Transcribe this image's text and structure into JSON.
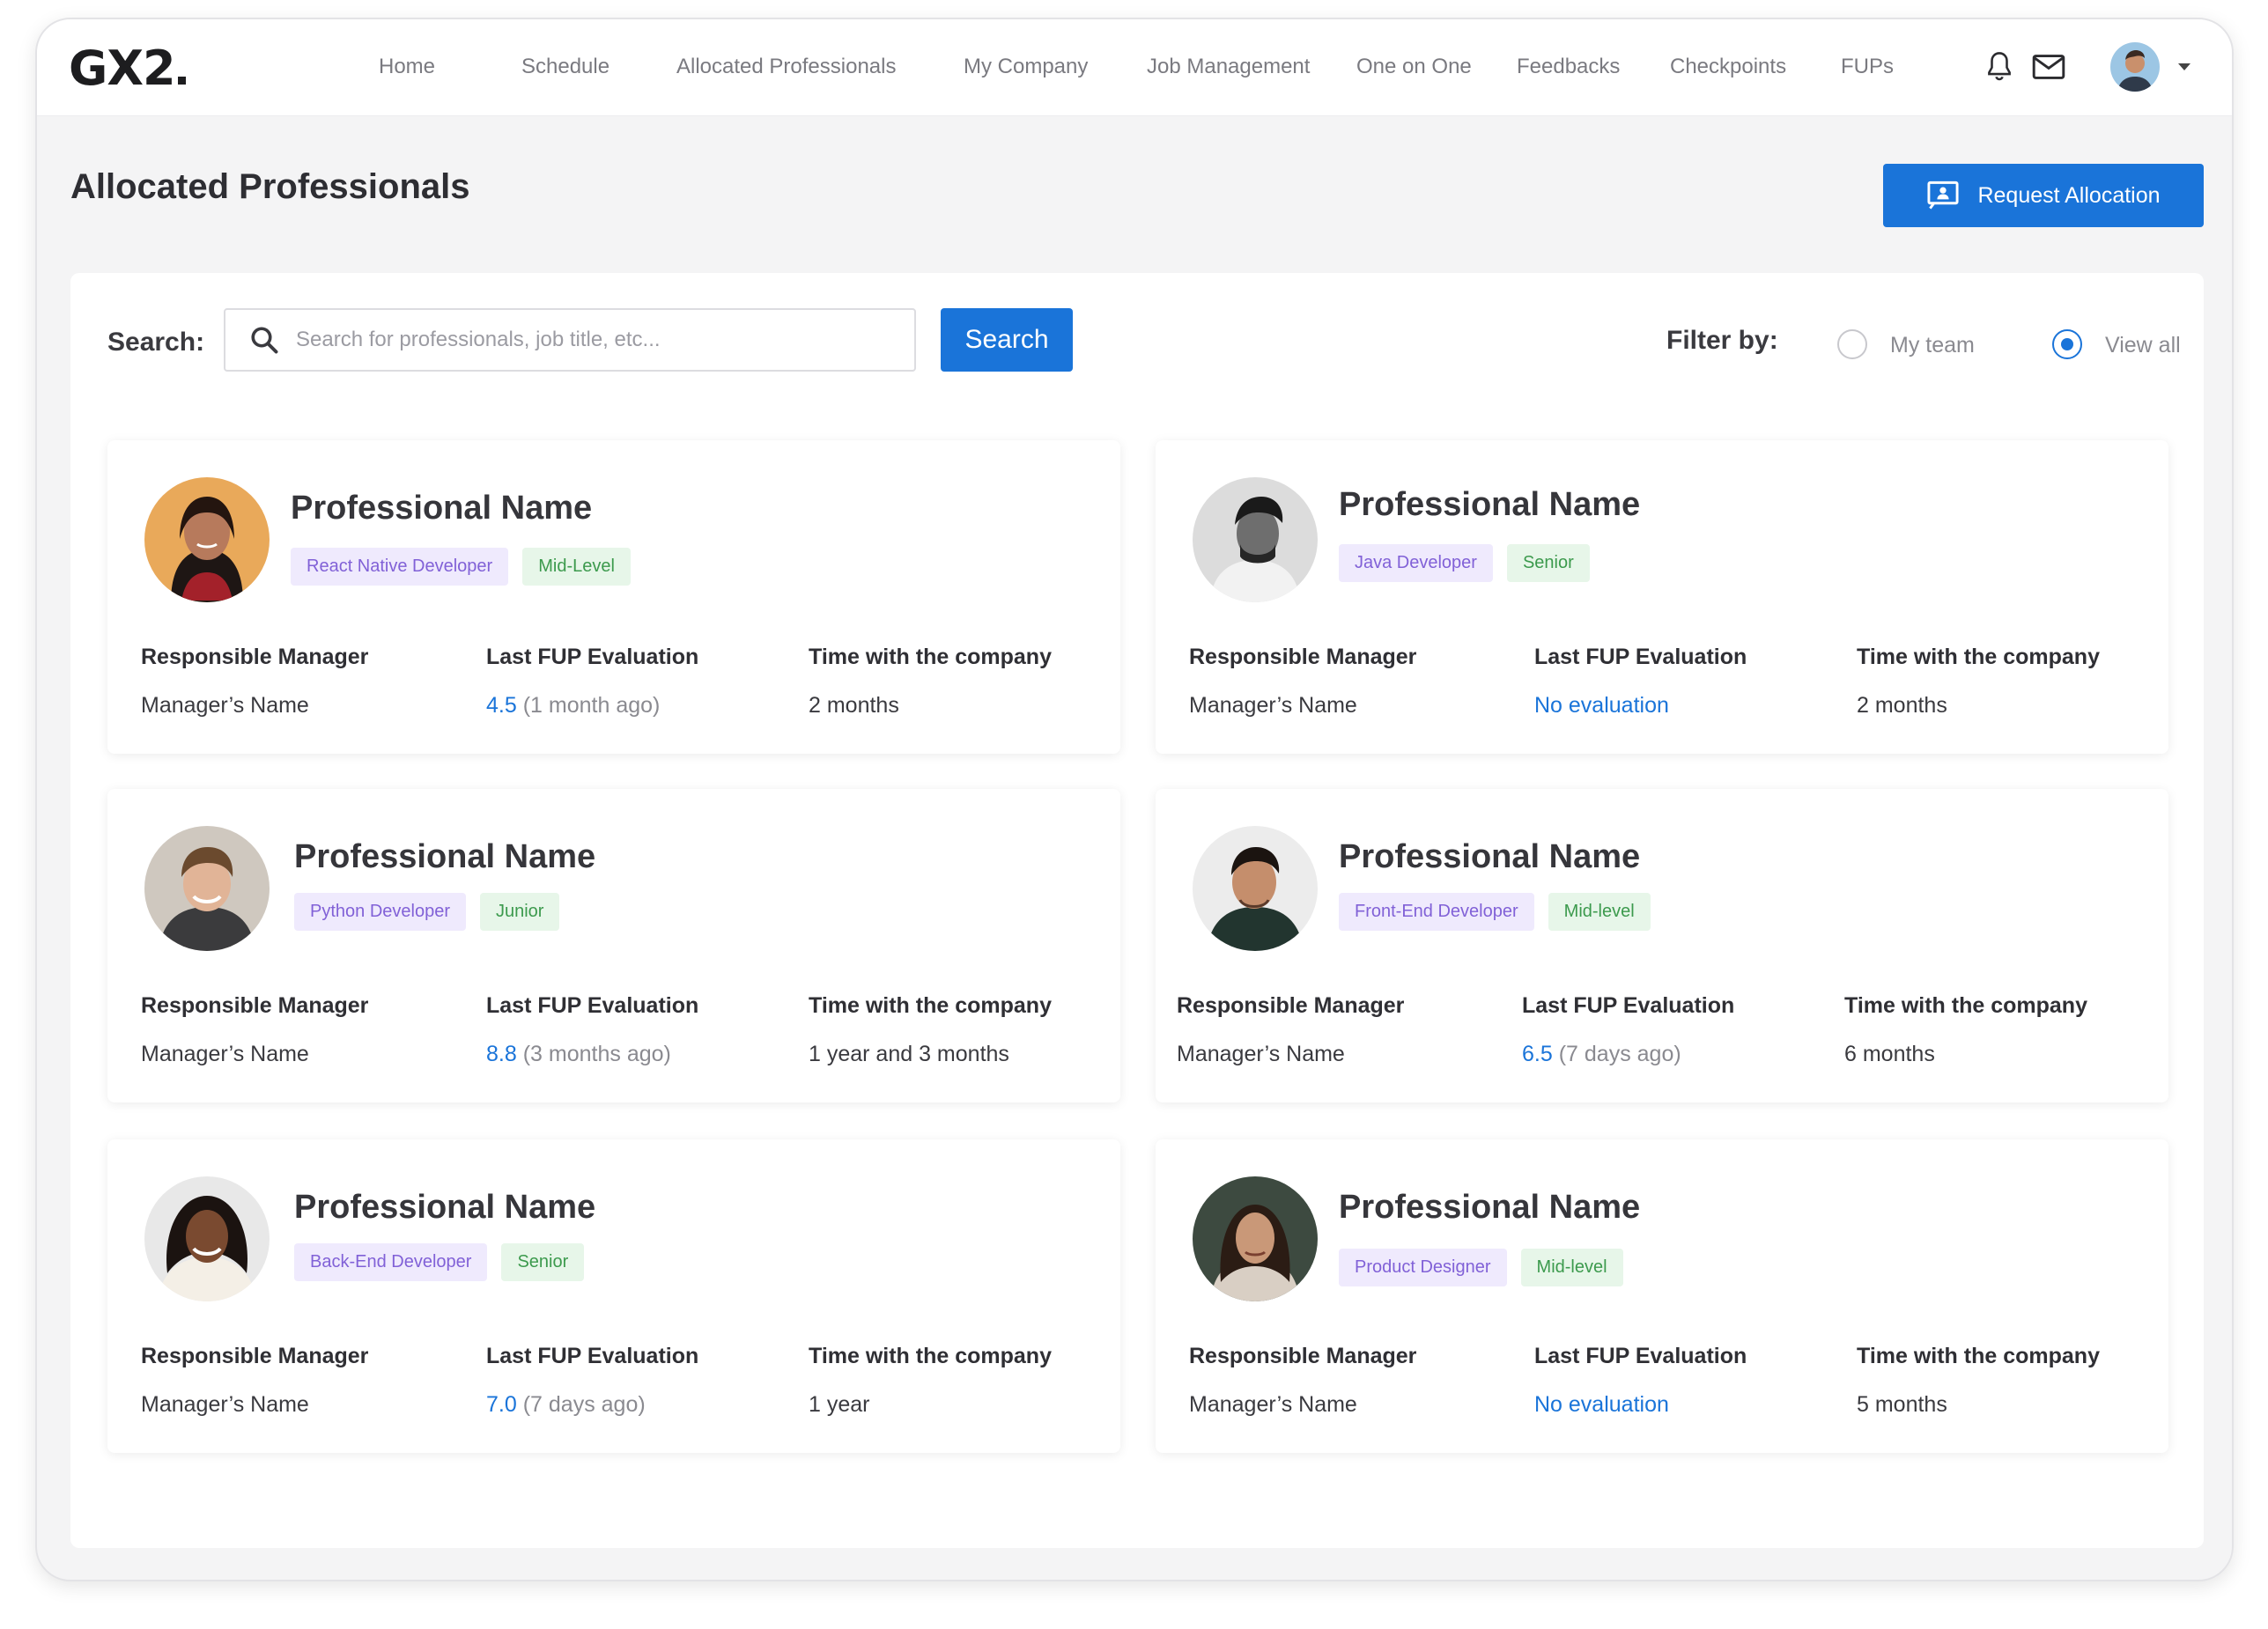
{
  "nav": {
    "logo": "GX2",
    "items": [
      "Home",
      "Schedule",
      "Allocated Professionals",
      "My Company",
      "Job Management",
      "One on One",
      "Feedbacks",
      "Checkpoints",
      "FUPs"
    ],
    "icons": [
      "bell-icon",
      "mail-icon",
      "chevron-down-icon"
    ]
  },
  "header": {
    "title": "Allocated Professionals",
    "request_button": "Request Allocation"
  },
  "search": {
    "label": "Search:",
    "placeholder": "Search for professionals, job title, etc...",
    "button": "Search"
  },
  "filter": {
    "label": "Filter by:",
    "options": [
      "My team",
      "View all"
    ],
    "selected": "View all"
  },
  "card_labels": {
    "manager": "Responsible Manager",
    "fup": "Last FUP Evaluation",
    "time": "Time with the company"
  },
  "professionals": [
    {
      "name": "Professional Name",
      "role": "React Native Developer",
      "level": "Mid-Level",
      "manager": "Manager’s Name",
      "fup_score": "4.5",
      "fup_ago": "(1 month ago)",
      "time": "2 months"
    },
    {
      "name": "Professional Name",
      "role": "Java Developer",
      "level": "Senior",
      "manager": "Manager’s Name",
      "fup_score": "No evaluation",
      "fup_ago": "",
      "time": "2 months"
    },
    {
      "name": "Professional Name",
      "role": "Python Developer",
      "level": "Junior",
      "manager": "Manager’s Name",
      "fup_score": "8.8",
      "fup_ago": "(3 months ago)",
      "time": "1 year and 3 months"
    },
    {
      "name": "Professional Name",
      "role": "Front-End Developer",
      "level": "Mid-level",
      "manager": "Manager’s Name",
      "fup_score": "6.5",
      "fup_ago": "(7 days ago)",
      "time": "6 months"
    },
    {
      "name": "Professional Name",
      "role": "Back-End Developer",
      "level": "Senior",
      "manager": "Manager’s Name",
      "fup_score": "7.0",
      "fup_ago": "(7 days ago)",
      "time": "1 year"
    },
    {
      "name": "Professional Name",
      "role": "Product Designer",
      "level": "Mid-level",
      "manager": "Manager’s Name",
      "fup_score": "No evaluation",
      "fup_ago": "",
      "time": "5 months"
    }
  ],
  "colors": {
    "primary": "#1a74d9",
    "role_tag": "#8161d7",
    "level_tag": "#3c9a4d"
  }
}
